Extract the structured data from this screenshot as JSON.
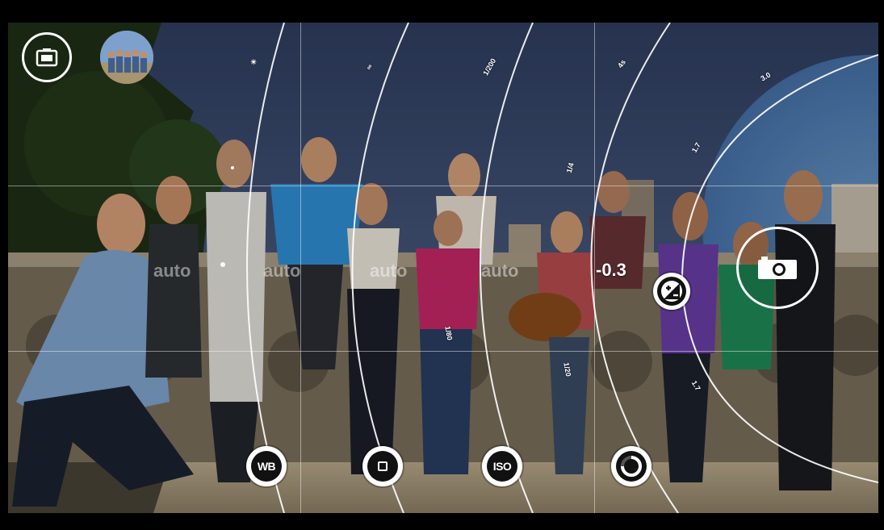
{
  "app": {
    "mode_labels": [
      "auto",
      "auto",
      "auto",
      "auto"
    ],
    "exposure_value": "-0.3",
    "dial_ticks": {
      "wb": "☀",
      "focus": "∞",
      "shutter_top": "1/200",
      "shutter_mid": "1/4",
      "shutter_low": "1/80",
      "iso_top": "4s",
      "ev_top": "3.0",
      "ev_mid": "1.7",
      "ev_low": "1.7",
      "iso_low": "1/20"
    }
  },
  "controls": {
    "wb": "WB",
    "focus_icon": "square-icon",
    "iso": "ISO",
    "shutter_icon": "shutter-ring-icon",
    "exposure_icon": "exposure-plus-minus-icon",
    "capture_icon": "camera-icon",
    "camera_roll_icon": "camera-roll-icon",
    "lens_thumb_icon": "lens-thumbnail-icon"
  },
  "colors": {
    "accent": "#ffffff",
    "sky": "#3a4e78",
    "ground": "#b7a98f"
  }
}
